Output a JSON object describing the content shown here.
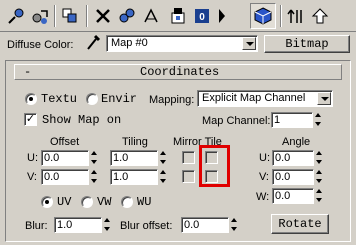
{
  "toolbar": {
    "icons": [
      "pick-material-icon",
      "put-to-scene-icon",
      "assign-to-selection-icon",
      "reset-map-icon",
      "make-unique-icon",
      "put-to-library-icon",
      "material-id-channel-icon",
      "show-map-icon",
      "show-end-result-icon",
      "go-to-parent-icon",
      "go-forward-icon"
    ]
  },
  "diffuse": {
    "label": "Diffuse Color:",
    "map_name": "Map #0",
    "type_button": "Bitmap"
  },
  "rollout": {
    "collapse_symbol": "-",
    "title": "Coordinates"
  },
  "coords": {
    "texture_label": "Textu",
    "environ_label": "Envir",
    "mapping_label": "Mapping:",
    "mapping_value": "Explicit Map Channel",
    "show_map_on_label": "Show Map on",
    "map_channel_label": "Map Channel:",
    "map_channel_value": "1",
    "offset_header": "Offset",
    "tiling_header": "Tiling",
    "mirror_tile_header": "Mirror Tile",
    "angle_header": "Angle",
    "u_label": "U:",
    "v_label": "V:",
    "w_label": "W:",
    "offset_u": "0.0",
    "offset_v": "0.0",
    "tiling_u": "1.0",
    "tiling_v": "1.0",
    "angle_u": "0.0",
    "angle_v": "0.0",
    "angle_w": "0.0",
    "uv_label": "UV",
    "vw_label": "VW",
    "wu_label": "WU",
    "blur_label": "Blur:",
    "blur_value": "1.0",
    "blur_offset_label": "Blur offset:",
    "blur_offset_value": "0.0",
    "rotate_button": "Rotate"
  },
  "highlight_color": "#e00000"
}
